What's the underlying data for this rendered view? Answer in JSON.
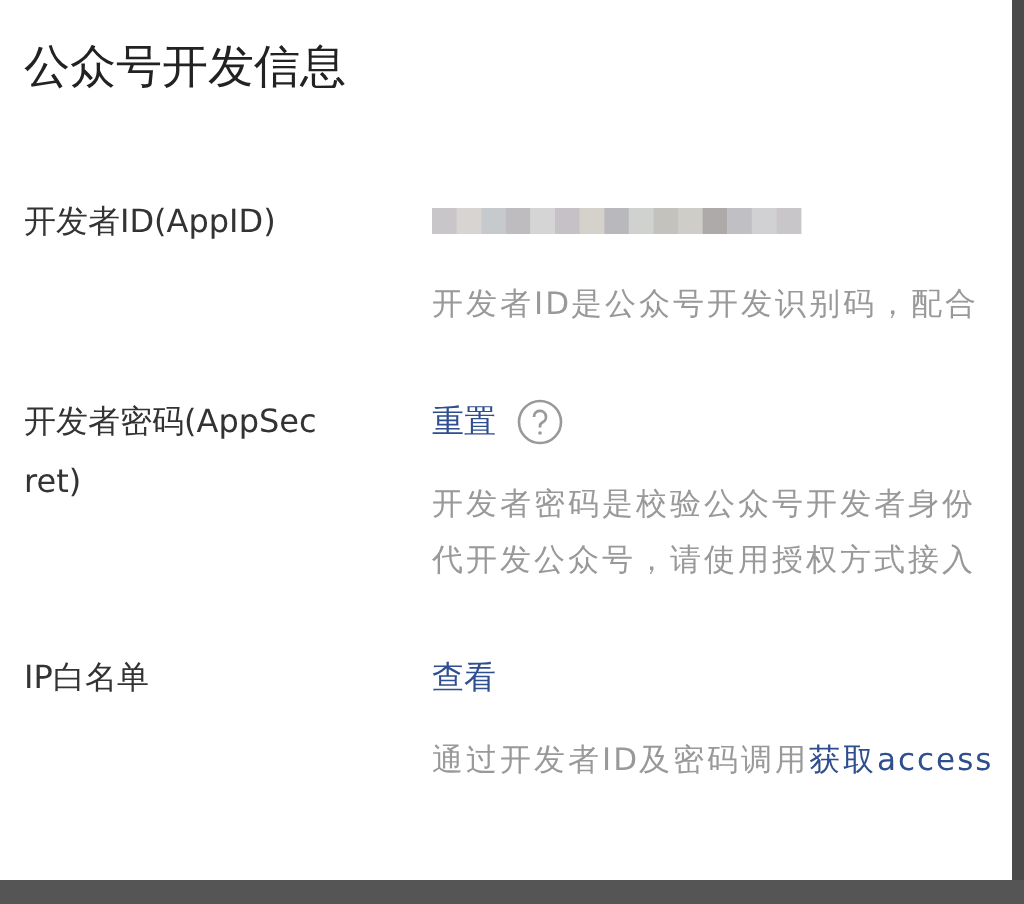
{
  "title": "公众号开发信息",
  "rows": [
    {
      "label": "开发者ID(AppID)",
      "kind": "masked",
      "notes": [
        {
          "text": "开发者ID是公众号开发识别码，配合"
        }
      ]
    },
    {
      "label": "开发者密码(AppSec ret)",
      "kind": "action",
      "action": "重置",
      "help": true,
      "notes": [
        {
          "text": "开发者密码是校验公众号开发者身份"
        },
        {
          "text": "代开发公众号，请使用授权方式接入"
        }
      ]
    },
    {
      "label": "IP白名单",
      "kind": "action",
      "action": "查看",
      "help": false,
      "notes": [
        {
          "text": "通过开发者ID及密码调用",
          "link": "获取access"
        }
      ]
    }
  ]
}
